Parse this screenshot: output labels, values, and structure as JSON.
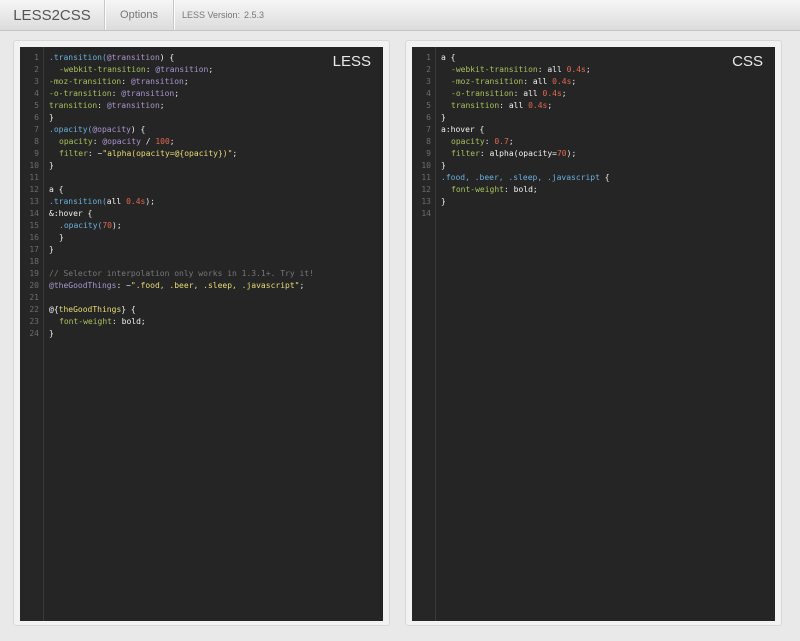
{
  "header": {
    "brand": "LESS2CSS",
    "options_label": "Options",
    "version_label": "LESS Version:",
    "version_value": "2.5.3"
  },
  "less_editor": {
    "label": "LESS",
    "line_count": 24,
    "lines": [
      [
        {
          "t": ".transition(",
          "c": "t-sel"
        },
        {
          "t": "@transition",
          "c": "t-var"
        },
        {
          "t": ") {",
          "c": "t-kw"
        }
      ],
      [
        {
          "t": "-webkit-transition",
          "c": "t-prop",
          "i": 1
        },
        {
          "t": ": ",
          "c": "t-txt"
        },
        {
          "t": "@transition",
          "c": "t-var"
        },
        {
          "t": ";",
          "c": "t-txt"
        }
      ],
      [
        {
          "t": "-moz-transition",
          "c": "t-prop"
        },
        {
          "t": ": ",
          "c": "t-txt"
        },
        {
          "t": "@transition",
          "c": "t-var"
        },
        {
          "t": ";",
          "c": "t-txt"
        }
      ],
      [
        {
          "t": "-o-transition",
          "c": "t-prop"
        },
        {
          "t": ": ",
          "c": "t-txt"
        },
        {
          "t": "@transition",
          "c": "t-var"
        },
        {
          "t": ";",
          "c": "t-txt"
        }
      ],
      [
        {
          "t": "transition",
          "c": "t-prop"
        },
        {
          "t": ": ",
          "c": "t-txt"
        },
        {
          "t": "@transition",
          "c": "t-var"
        },
        {
          "t": ";",
          "c": "t-txt"
        }
      ],
      [
        {
          "t": "}",
          "c": "t-kw"
        }
      ],
      [
        {
          "t": ".opacity(",
          "c": "t-sel"
        },
        {
          "t": "@opacity",
          "c": "t-var"
        },
        {
          "t": ") {",
          "c": "t-kw"
        }
      ],
      [
        {
          "t": "opacity",
          "c": "t-prop",
          "i": 1
        },
        {
          "t": ": ",
          "c": "t-txt"
        },
        {
          "t": "@opacity",
          "c": "t-var"
        },
        {
          "t": " / ",
          "c": "t-txt"
        },
        {
          "t": "100",
          "c": "t-num"
        },
        {
          "t": ";",
          "c": "t-txt"
        }
      ],
      [
        {
          "t": "filter",
          "c": "t-prop",
          "i": 1
        },
        {
          "t": ": ~",
          "c": "t-txt"
        },
        {
          "t": "\"alpha(opacity=@{opacity})\"",
          "c": "t-str"
        },
        {
          "t": ";",
          "c": "t-txt"
        }
      ],
      [
        {
          "t": "}",
          "c": "t-kw"
        }
      ],
      [],
      [
        {
          "t": "a {",
          "c": "t-kw"
        }
      ],
      [
        {
          "t": ".transition(",
          "c": "t-sel"
        },
        {
          "t": "all ",
          "c": "t-kw"
        },
        {
          "t": "0.4s",
          "c": "t-num"
        },
        {
          "t": ");",
          "c": "t-txt"
        }
      ],
      [
        {
          "t": "&:hover {",
          "c": "t-kw"
        }
      ],
      [
        {
          "t": ".opacity(",
          "c": "t-sel",
          "i": 1
        },
        {
          "t": "70",
          "c": "t-num"
        },
        {
          "t": ");",
          "c": "t-txt"
        }
      ],
      [
        {
          "t": "}",
          "c": "t-kw",
          "i": 1
        }
      ],
      [
        {
          "t": "}",
          "c": "t-kw"
        }
      ],
      [],
      [
        {
          "t": "// Selector interpolation only works in 1.3.1+. Try it!",
          "c": "t-com"
        }
      ],
      [
        {
          "t": "@theGoodThings",
          "c": "t-var"
        },
        {
          "t": ": ~",
          "c": "t-txt"
        },
        {
          "t": "\".food, .beer, .sleep, .javascript\"",
          "c": "t-str"
        },
        {
          "t": ";",
          "c": "t-txt"
        }
      ],
      [],
      [
        {
          "t": "@{",
          "c": "t-kw"
        },
        {
          "t": "theGoodThings",
          "c": "t-str"
        },
        {
          "t": "} {",
          "c": "t-kw"
        }
      ],
      [
        {
          "t": "font-weight",
          "c": "t-prop",
          "i": 1
        },
        {
          "t": ": ",
          "c": "t-txt"
        },
        {
          "t": "bold",
          "c": "t-kw"
        },
        {
          "t": ";",
          "c": "t-txt"
        }
      ],
      [
        {
          "t": "}",
          "c": "t-kw"
        }
      ]
    ]
  },
  "css_editor": {
    "label": "CSS",
    "line_count": 14,
    "lines": [
      [
        {
          "t": "a {",
          "c": "t-kw"
        }
      ],
      [
        {
          "t": "-webkit-transition",
          "c": "t-prop",
          "i": 1
        },
        {
          "t": ": ",
          "c": "t-txt"
        },
        {
          "t": "all ",
          "c": "t-kw"
        },
        {
          "t": "0.4s",
          "c": "t-num"
        },
        {
          "t": ";",
          "c": "t-txt"
        }
      ],
      [
        {
          "t": "-moz-transition",
          "c": "t-prop",
          "i": 1
        },
        {
          "t": ": ",
          "c": "t-txt"
        },
        {
          "t": "all ",
          "c": "t-kw"
        },
        {
          "t": "0.4s",
          "c": "t-num"
        },
        {
          "t": ";",
          "c": "t-txt"
        }
      ],
      [
        {
          "t": "-o-transition",
          "c": "t-prop",
          "i": 1
        },
        {
          "t": ": ",
          "c": "t-txt"
        },
        {
          "t": "all ",
          "c": "t-kw"
        },
        {
          "t": "0.4s",
          "c": "t-num"
        },
        {
          "t": ";",
          "c": "t-txt"
        }
      ],
      [
        {
          "t": "transition",
          "c": "t-prop",
          "i": 1
        },
        {
          "t": ": ",
          "c": "t-txt"
        },
        {
          "t": "all ",
          "c": "t-kw"
        },
        {
          "t": "0.4s",
          "c": "t-num"
        },
        {
          "t": ";",
          "c": "t-txt"
        }
      ],
      [
        {
          "t": "}",
          "c": "t-kw"
        }
      ],
      [
        {
          "t": "a:hover {",
          "c": "t-kw"
        }
      ],
      [
        {
          "t": "opacity",
          "c": "t-prop",
          "i": 1
        },
        {
          "t": ": ",
          "c": "t-txt"
        },
        {
          "t": "0.7",
          "c": "t-num"
        },
        {
          "t": ";",
          "c": "t-txt"
        }
      ],
      [
        {
          "t": "filter",
          "c": "t-prop",
          "i": 1
        },
        {
          "t": ": ",
          "c": "t-txt"
        },
        {
          "t": "alpha(opacity=",
          "c": "t-kw"
        },
        {
          "t": "70",
          "c": "t-num"
        },
        {
          "t": ");",
          "c": "t-txt"
        }
      ],
      [
        {
          "t": "}",
          "c": "t-kw"
        }
      ],
      [
        {
          "t": ".food, .beer, .sleep, .javascript",
          "c": "t-sel"
        },
        {
          "t": " {",
          "c": "t-kw"
        }
      ],
      [
        {
          "t": "font-weight",
          "c": "t-prop",
          "i": 1
        },
        {
          "t": ": ",
          "c": "t-txt"
        },
        {
          "t": "bold",
          "c": "t-kw"
        },
        {
          "t": ";",
          "c": "t-txt"
        }
      ],
      [
        {
          "t": "}",
          "c": "t-kw"
        }
      ],
      []
    ]
  }
}
